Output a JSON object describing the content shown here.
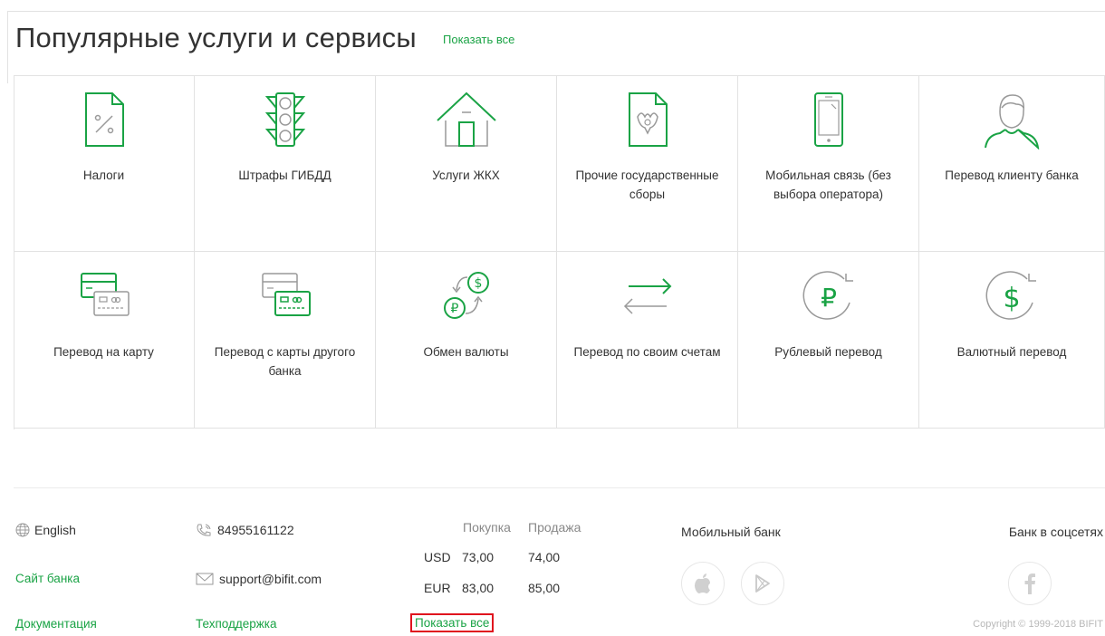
{
  "header": {
    "title": "Популярные услуги и сервисы",
    "show_all": "Показать все"
  },
  "services": [
    {
      "label": "Налоги",
      "icon": "tax-document-icon"
    },
    {
      "label": "Штрафы ГИБДД",
      "icon": "traffic-light-icon"
    },
    {
      "label": "Услуги ЖКХ",
      "icon": "house-icon"
    },
    {
      "label": "Прочие государственные сборы",
      "icon": "state-emblem-document-icon"
    },
    {
      "label": "Мобильная связь (без выбора оператора)",
      "icon": "mobile-phone-icon"
    },
    {
      "label": "Перевод клиенту банка",
      "icon": "person-icon"
    },
    {
      "label": "Перевод на карту",
      "icon": "card-to-card-icon"
    },
    {
      "label": "Перевод с карты другого банка",
      "icon": "card-from-card-icon"
    },
    {
      "label": "Обмен валюты",
      "icon": "currency-exchange-icon"
    },
    {
      "label": "Перевод по своим счетам",
      "icon": "transfer-arrows-icon"
    },
    {
      "label": "Рублевый перевод",
      "icon": "ruble-icon"
    },
    {
      "label": "Валютный перевод",
      "icon": "dollar-icon"
    }
  ],
  "footer": {
    "language": "English",
    "phone": "84955161122",
    "email": "support@bifit.com",
    "bank_site": "Сайт банка",
    "docs": "Документация",
    "support": "Техподдержка",
    "rates": {
      "buy_header": "Покупка",
      "sell_header": "Продажа",
      "rows": [
        {
          "currency": "USD",
          "buy": "73,00",
          "sell": "74,00"
        },
        {
          "currency": "EUR",
          "buy": "83,00",
          "sell": "85,00"
        }
      ],
      "show_all": "Показать все"
    },
    "mobile_bank": "Мобильный банк",
    "social": "Банк в соцсетях",
    "copyright": "Copyright © 1999-2018 BIFIT"
  },
  "colors": {
    "accent": "#1aa345",
    "border": "#e2e2e2",
    "highlight": "#e0141e"
  }
}
